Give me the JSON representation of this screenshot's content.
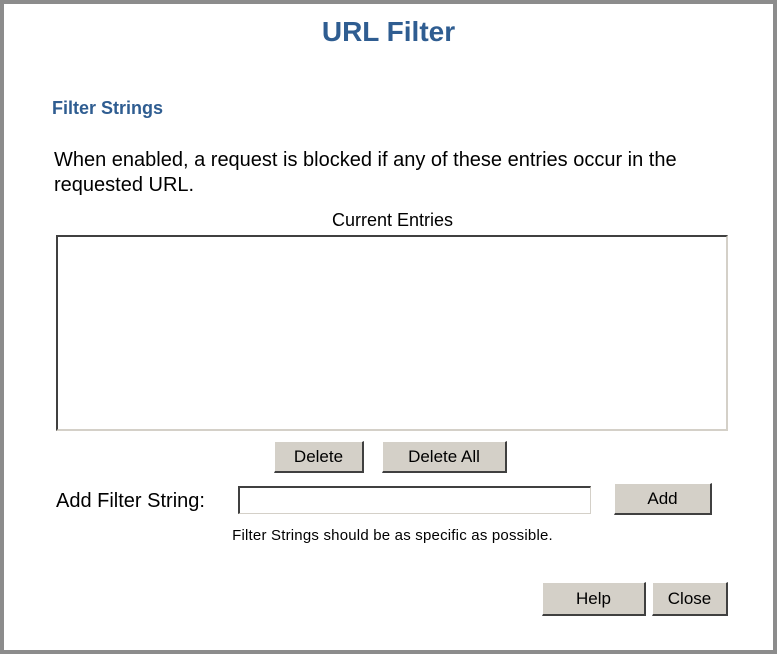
{
  "page": {
    "title": "URL Filter"
  },
  "section": {
    "title": "Filter Strings",
    "description": "When enabled, a request is blocked if any of these entries occur in the requested URL."
  },
  "entries": {
    "label": "Current Entries",
    "items": []
  },
  "list_buttons": {
    "delete_label": "Delete",
    "delete_all_label": "Delete All"
  },
  "add_filter": {
    "label": "Add Filter String:",
    "value": "",
    "placeholder": "",
    "add_label": "Add",
    "hint": "Filter Strings should be as specific as possible."
  },
  "footer": {
    "help_label": "Help",
    "close_label": "Close"
  }
}
